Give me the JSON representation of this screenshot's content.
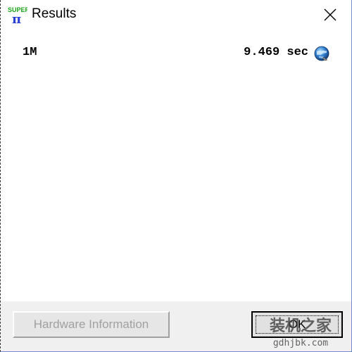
{
  "window": {
    "title": "Results",
    "icon": "superpi-app-icon",
    "icon_text_top": "SUPER",
    "icon_text_bottom": "π"
  },
  "titlebar": {
    "close_icon": "close-icon"
  },
  "result": {
    "label": "1M",
    "time": "9.469 sec",
    "icon": "globe-icon"
  },
  "buttons": {
    "hardware_info": "Hardware Information",
    "ok": "OK"
  },
  "watermark": {
    "line1": "装机之家",
    "line2": "gdhjbk.com"
  },
  "colors": {
    "icon_green": "#1aa31a",
    "icon_blue": "#2a3fd6",
    "disabled_text": "#a0a0a0",
    "footer_bg": "#f0f0f0",
    "window_border": "#6b8fcf"
  }
}
